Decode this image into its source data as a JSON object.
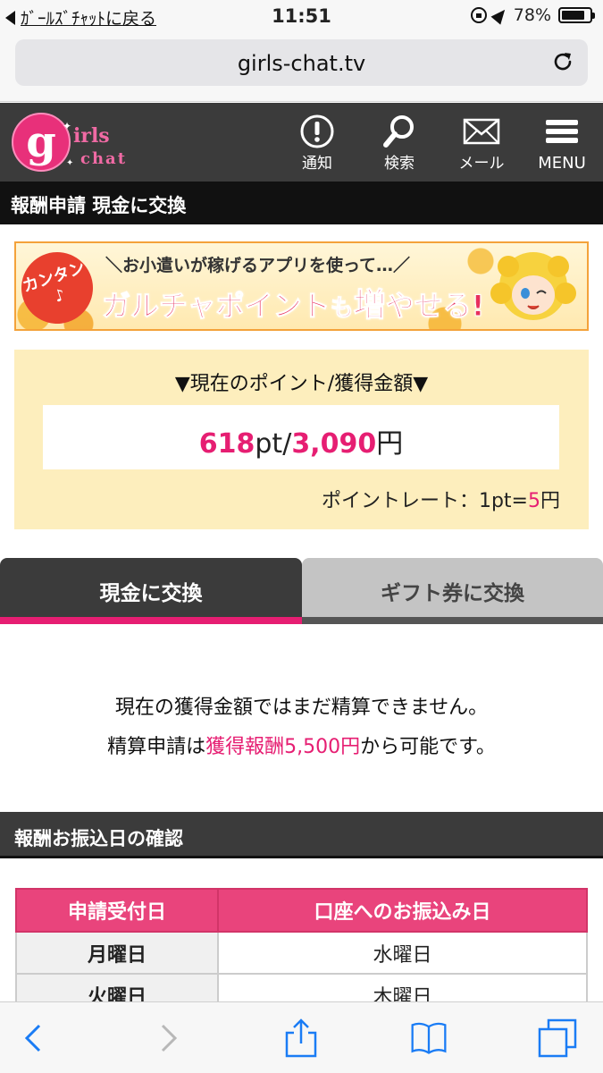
{
  "status_bar": {
    "back_label": "ｶﾞｰﾙｽﾞﾁｬｯﾄに戻る",
    "time": "11:51",
    "battery": "78%"
  },
  "browser": {
    "url": "girls-chat.tv"
  },
  "header": {
    "logo_text": "girls chat",
    "nav": [
      {
        "label": "通知",
        "icon": "exclamation-icon"
      },
      {
        "label": "検索",
        "icon": "search-icon"
      },
      {
        "label": "メール",
        "icon": "mail-icon"
      },
      {
        "label": "MENU",
        "icon": "menu-icon"
      }
    ]
  },
  "page_title": "報酬申請 現金に交換",
  "banner": {
    "badge": "カンタン♪",
    "line1": "＼お小遣いが稼げるアプリを使って…／",
    "line2_a": "ガルチャポイント",
    "line2_b": "も",
    "line2_c": "増",
    "line2_d": "やせる!"
  },
  "points": {
    "heading": "▼現在のポイント/獲得金額▼",
    "pt_value": "618",
    "pt_unit": "pt/",
    "yen_value": "3,090",
    "yen_unit": "円",
    "rate_prefix": "ポイントレート：1pt=",
    "rate_value": "5",
    "rate_suffix": "円"
  },
  "tabs": [
    {
      "label": "現金に交換",
      "active": true
    },
    {
      "label": "ギフト券に交換",
      "active": false
    }
  ],
  "notice": {
    "line1": "現在の獲得金額ではまだ精算できません。",
    "line2_prefix": "精算申請は",
    "line2_highlight": "獲得報酬5,500円",
    "line2_suffix": "から可能です。"
  },
  "schedule": {
    "title": "報酬お振込日の確認",
    "headers": [
      "申請受付日",
      "口座へのお振込み日"
    ],
    "rows": [
      [
        "月曜日",
        "水曜日"
      ],
      [
        "火曜日",
        "木曜日"
      ]
    ]
  },
  "colors": {
    "accent_pink": "#e61e72",
    "header_dark": "#3b3b3b",
    "points_bg": "#fdeebd",
    "table_head": "#e9447c"
  }
}
